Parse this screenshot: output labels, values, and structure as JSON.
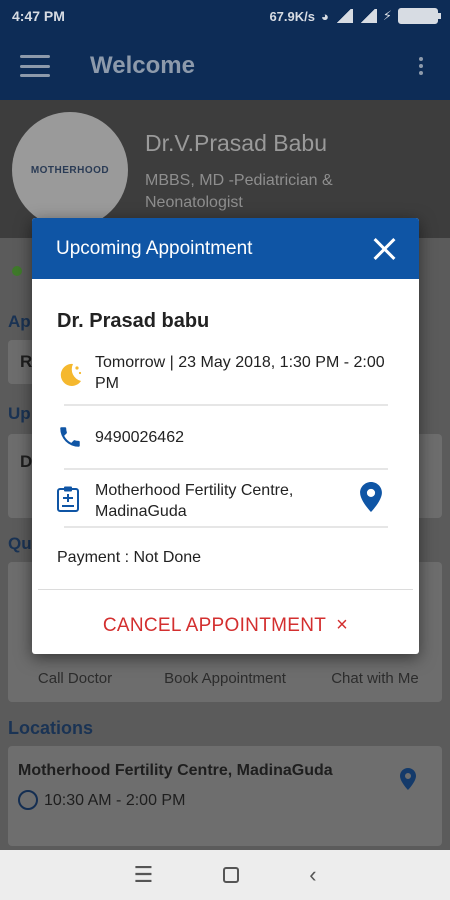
{
  "status_bar": {
    "time": "4:47 PM",
    "net_speed": "67.9K/s"
  },
  "app_bar": {
    "title": "Welcome"
  },
  "profile": {
    "logo_text": "MOTHERHOOD",
    "doctor_name": "Dr.V.Prasad Babu",
    "qualification": "MBBS, MD -Pediatrician & Neonatologist"
  },
  "background": {
    "fragments": [
      "Ap",
      "R",
      "Up",
      "D",
      "Qu"
    ],
    "quick_actions": [
      "Call Doctor",
      "Book Appointment",
      "Chat with Me"
    ],
    "locations_heading": "Locations",
    "location_name": "Motherhood Fertility Centre, MadinaGuda",
    "location_time": "10:30 AM - 2:00 PM"
  },
  "dialog": {
    "title": "Upcoming Appointment",
    "doctor": "Dr. Prasad babu",
    "datetime": "Tomorrow | 23 May 2018, 1:30 PM - 2:00 PM",
    "phone": "9490026462",
    "clinic": "Motherhood Fertility Centre, MadinaGuda",
    "payment": "Payment : Not Done",
    "cancel_label": "CANCEL APPOINTMENT",
    "cancel_icon": "×"
  },
  "colors": {
    "primary": "#0f55a5",
    "dark_primary": "#0d2c56",
    "danger": "#d32f2f",
    "moon": "#f5b82e"
  }
}
